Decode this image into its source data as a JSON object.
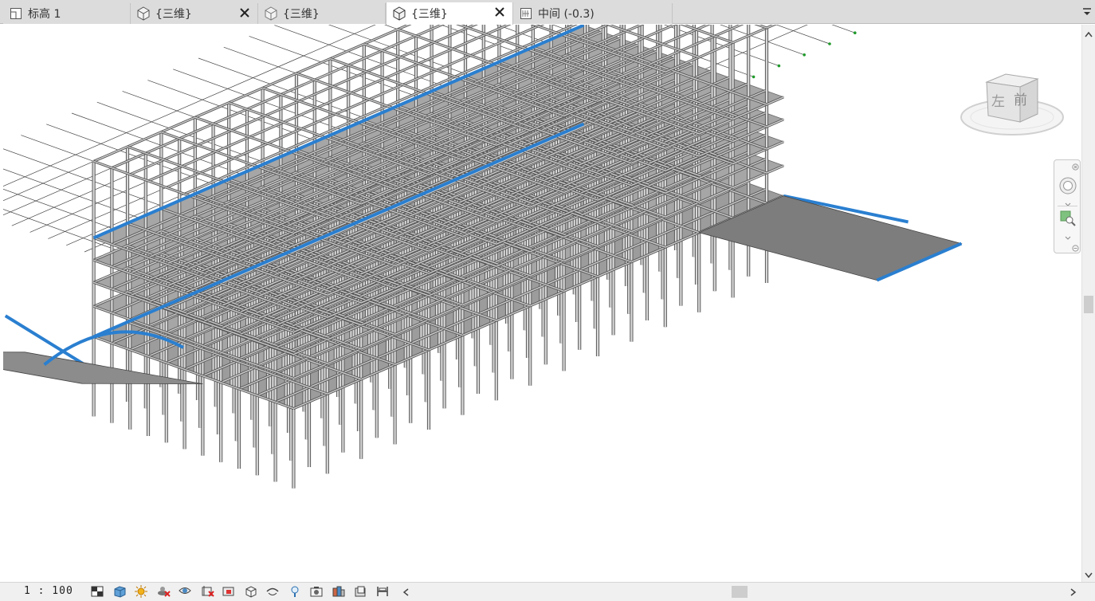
{
  "tabs": [
    {
      "label": "标高 1",
      "icon": "floor-plan-icon",
      "active": false,
      "closable": false
    },
    {
      "label": "{三维}",
      "icon": "3d-view-icon",
      "active": false,
      "closable": true
    },
    {
      "label": "{三维}",
      "icon": "3d-view-icon",
      "active": false,
      "closable": false
    },
    {
      "label": "{三维}",
      "icon": "3d-view-icon",
      "active": true,
      "closable": true
    },
    {
      "label": "中间 (-0.3)",
      "icon": "section-view-icon",
      "active": false,
      "closable": false
    }
  ],
  "viewcube": {
    "left_face": "左",
    "front_face": "前"
  },
  "statusbar": {
    "scale": "1 : 100",
    "icons": [
      "detail-level-icon",
      "visual-style-icon",
      "sun-path-icon",
      "shadows-off-icon",
      "rendering-icon",
      "crop-view-icon",
      "show-crop-icon",
      "unlock-3d-icon",
      "temporary-hide-icon",
      "reveal-hidden-icon",
      "worksharing-display-icon",
      "analytical-model-icon",
      "highlight-displacement-icon",
      "constraints-icon"
    ]
  },
  "colors": {
    "accent_blue": "#2a7fd0",
    "frame_gray": "#8a8a8a",
    "grid_green": "#1f9a2a"
  }
}
